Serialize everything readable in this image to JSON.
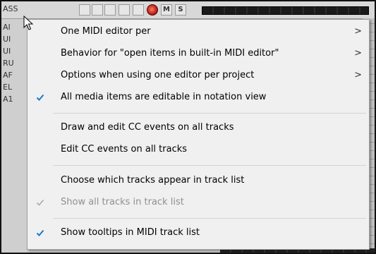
{
  "background": {
    "track_name": "ASS",
    "buttons": {
      "mute_label": "M",
      "solo_label": "S"
    },
    "side_labels": [
      "AI",
      "UI",
      "UI",
      "RU",
      "AF",
      "EL",
      "A1"
    ]
  },
  "menu": {
    "items": [
      {
        "label": "One MIDI editor per",
        "submenu": true,
        "checked": false,
        "enabled": true
      },
      {
        "label": "Behavior for \"open items in built-in MIDI editor\"",
        "submenu": true,
        "checked": false,
        "enabled": true
      },
      {
        "label": "Options when using one editor per project",
        "submenu": true,
        "checked": false,
        "enabled": true
      },
      {
        "label": "All media items are editable in notation view",
        "submenu": false,
        "checked": true,
        "enabled": true
      },
      {
        "label": "Draw and edit CC events on all tracks",
        "submenu": false,
        "checked": false,
        "enabled": true
      },
      {
        "label": "Edit CC events on all tracks",
        "submenu": false,
        "checked": false,
        "enabled": true
      },
      {
        "label": "Choose which tracks appear in track list",
        "submenu": false,
        "checked": false,
        "enabled": true
      },
      {
        "label": "Show all tracks in track list",
        "submenu": false,
        "checked": true,
        "enabled": false
      },
      {
        "label": "Show tooltips in MIDI track list",
        "submenu": false,
        "checked": true,
        "enabled": true
      }
    ],
    "submenu_arrow": ">",
    "colors": {
      "check": "#1f77d0",
      "check_disabled": "#a8a8a8",
      "disabled_text": "#8f8f8f"
    }
  }
}
